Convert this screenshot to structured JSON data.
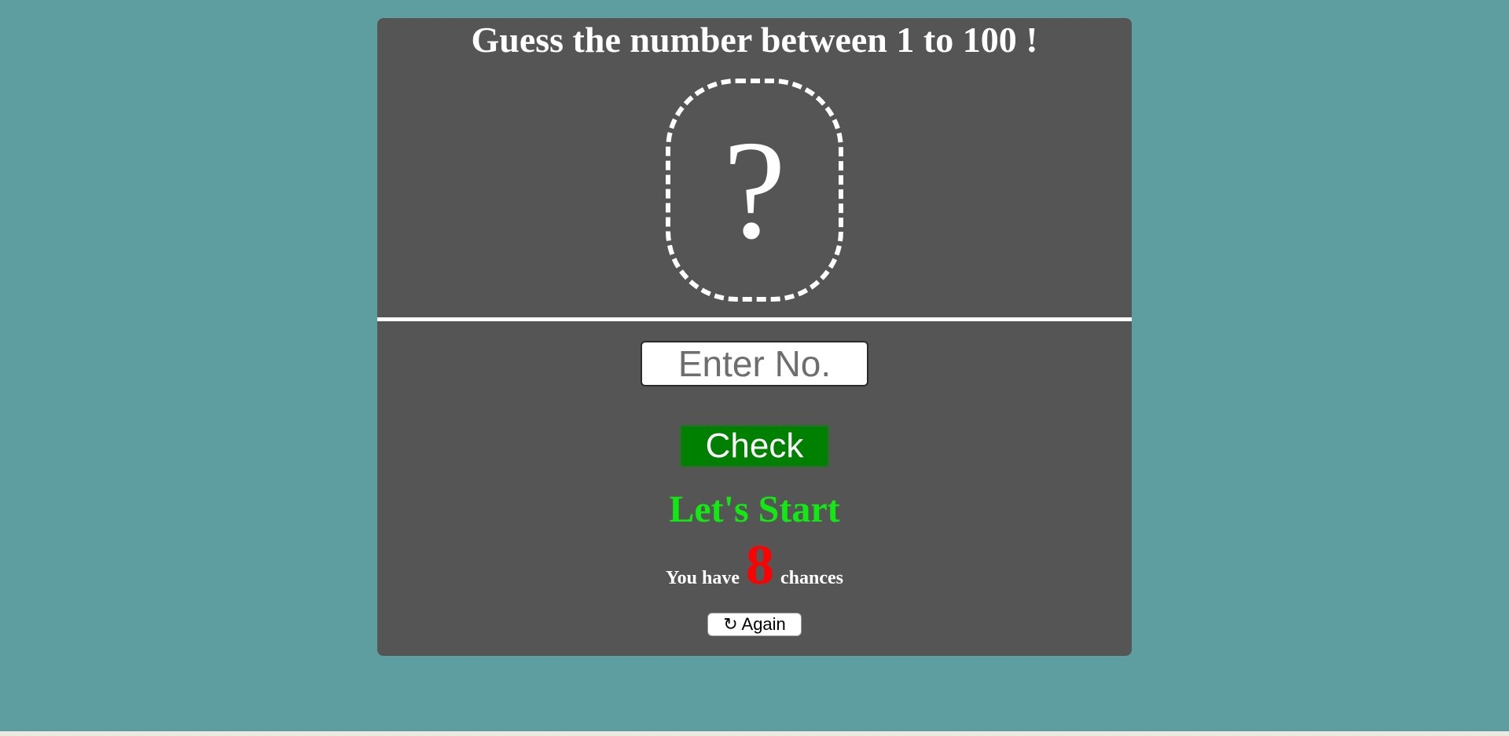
{
  "game": {
    "title": "Guess the number between 1 to 100 !",
    "hidden_symbol": "?",
    "input": {
      "placeholder": "Enter No.",
      "value": ""
    },
    "check_label": "Check",
    "status": "Let's Start",
    "chances_prefix": "You have",
    "chances_count": "8",
    "chances_suffix": "chances",
    "again_label": "↻ Again"
  },
  "colors": {
    "page_background": "#5f9ea0",
    "card_background": "#555555",
    "check_button": "#008000",
    "status_text": "#12e912",
    "chances_count": "#ff0000"
  }
}
